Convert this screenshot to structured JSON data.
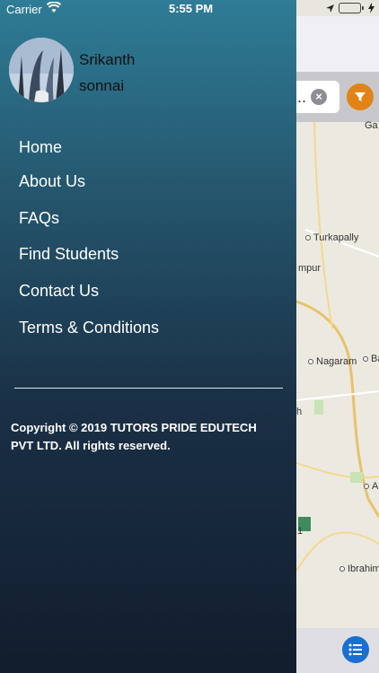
{
  "status_bar": {
    "carrier": "Carrier",
    "time": "5:55 PM",
    "battery_level": 1.0
  },
  "drawer": {
    "user": {
      "first_name": "Srikanth",
      "last_name": "sonnai"
    },
    "menu": [
      {
        "label": "Home"
      },
      {
        "label": "About Us"
      },
      {
        "label": "FAQs"
      },
      {
        "label": "Find Students"
      },
      {
        "label": "Contact Us"
      },
      {
        "label": "Terms & Conditions"
      }
    ],
    "copyright": "Copyright © 2019 TUTORS PRIDE EDUTECH PVT LTD. All rights reserved."
  },
  "map": {
    "search_text": "...",
    "places": [
      "Ga",
      "Turkapally",
      "mpur",
      "Nagaram",
      "Ba",
      "h",
      "Ab",
      "1",
      "Ibrahim"
    ]
  },
  "colors": {
    "drawer_top": "#2f7c96",
    "drawer_bottom": "#121d2d",
    "filter_accent": "#e28316",
    "list_button": "#1a6fd1"
  }
}
